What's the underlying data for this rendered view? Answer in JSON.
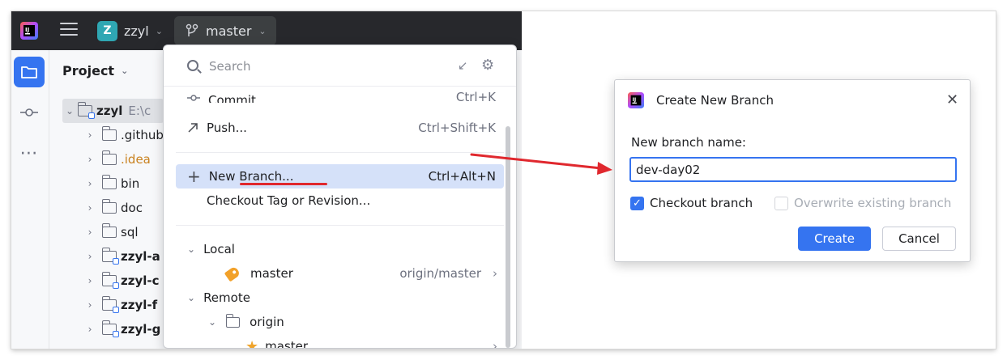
{
  "titlebar": {
    "project_initial": "Z",
    "project_name": "zzyl",
    "branch_name": "master"
  },
  "toolstrip": {
    "items": [
      "folder-icon",
      "commit-icon",
      "more-icon"
    ]
  },
  "project_panel": {
    "title": "Project",
    "root": {
      "name": "zzyl",
      "path": "E:\\c"
    },
    "items": [
      {
        "label": ".github",
        "style": "normal"
      },
      {
        "label": ".idea",
        "style": "orange"
      },
      {
        "label": "bin",
        "style": "normal"
      },
      {
        "label": "doc",
        "style": "normal"
      },
      {
        "label": "sql",
        "style": "normal"
      },
      {
        "label": "zzyl-a",
        "style": "module"
      },
      {
        "label": "zzyl-c",
        "style": "module"
      },
      {
        "label": "zzyl-f",
        "style": "module"
      },
      {
        "label": "zzyl-g",
        "style": "module"
      }
    ]
  },
  "popup": {
    "search_placeholder": "Search",
    "commit": {
      "label": "Commit...",
      "shortcut": "Ctrl+K"
    },
    "push": {
      "label": "Push...",
      "shortcut": "Ctrl+Shift+K"
    },
    "new_branch": {
      "label": "New Branch...",
      "shortcut": "Ctrl+Alt+N"
    },
    "checkout_tag": {
      "label": "Checkout Tag or Revision..."
    },
    "local": {
      "label": "Local",
      "branch": "master",
      "tracking": "origin/master"
    },
    "remote": {
      "label": "Remote",
      "remote_name": "origin",
      "branch": "master"
    }
  },
  "dialog": {
    "title": "Create New Branch",
    "name_label": "New branch name:",
    "branch_name_value": "dev-day02",
    "checkout_label": "Checkout branch",
    "checkout_checked": true,
    "overwrite_label": "Overwrite existing branch",
    "overwrite_checked": false,
    "create_label": "Create",
    "cancel_label": "Cancel"
  },
  "colors": {
    "accent": "#3574f0",
    "annotation_red": "#e0282e",
    "titlebar_bg": "#27282c"
  }
}
